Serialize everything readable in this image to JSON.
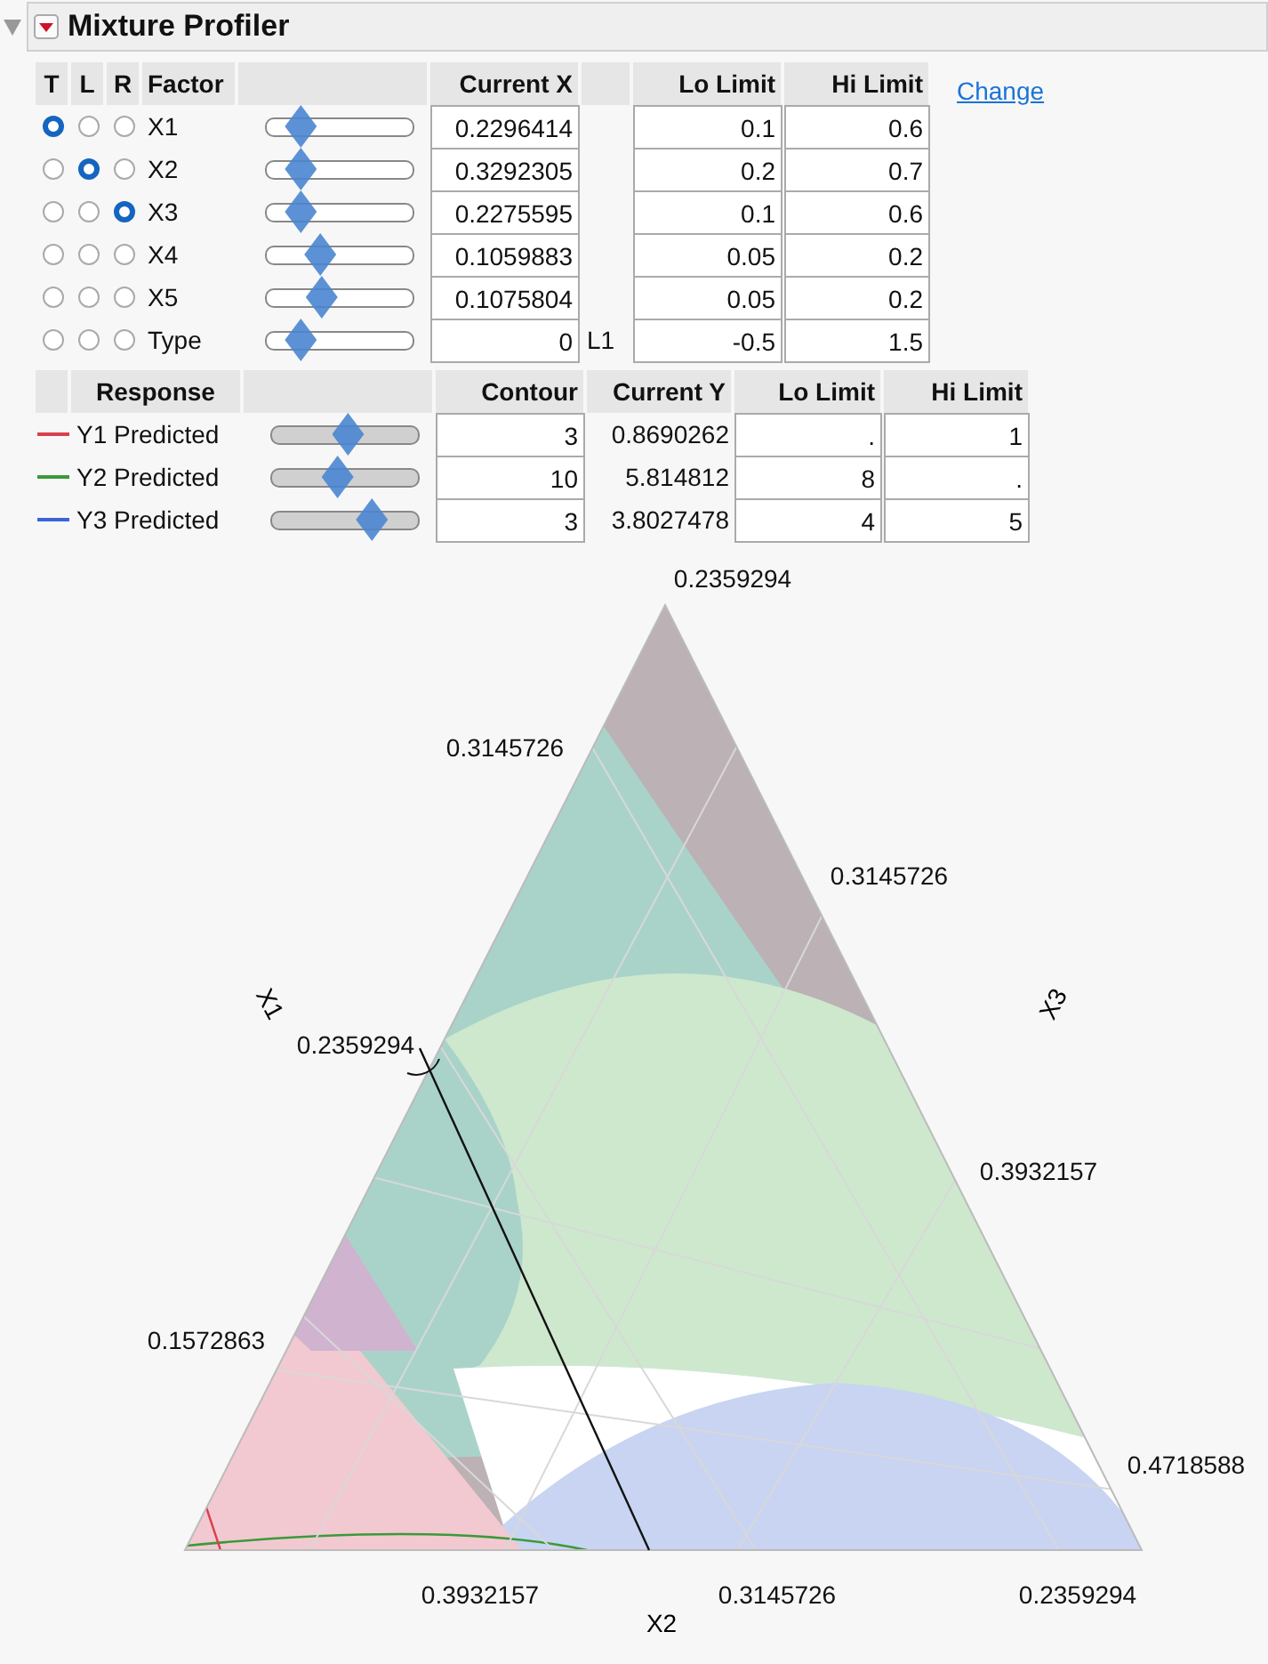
{
  "title": "Mixture Profiler",
  "factor_table": {
    "columns": [
      "T",
      "L",
      "R",
      "Factor",
      "Current X",
      "Lo Limit",
      "Hi Limit"
    ],
    "rows": [
      {
        "t": true,
        "l": false,
        "r": false,
        "name": "X1",
        "level": 0.24,
        "current": "0.2296414",
        "lo": "0.1",
        "hi": "0.6"
      },
      {
        "t": false,
        "l": true,
        "r": false,
        "name": "X2",
        "level": 0.24,
        "current": "0.3292305",
        "lo": "0.2",
        "hi": "0.7"
      },
      {
        "t": false,
        "l": false,
        "r": true,
        "name": "X3",
        "level": 0.24,
        "current": "0.2275595",
        "lo": "0.1",
        "hi": "0.6"
      },
      {
        "t": false,
        "l": false,
        "r": false,
        "name": "X4",
        "level": 0.37,
        "current": "0.1059883",
        "lo": "0.05",
        "hi": "0.2"
      },
      {
        "t": false,
        "l": false,
        "r": false,
        "name": "X5",
        "level": 0.38,
        "current": "0.1075804",
        "lo": "0.05",
        "hi": "0.2"
      },
      {
        "t": false,
        "l": false,
        "r": false,
        "name": "Type",
        "level": 0.24,
        "current": "0",
        "unit": "L1",
        "lo": "-0.5",
        "hi": "1.5"
      }
    ]
  },
  "change_link": "Change",
  "response_table": {
    "columns": [
      "Response",
      "Contour",
      "Current Y",
      "Lo Limit",
      "Hi Limit"
    ],
    "rows": [
      {
        "name": "Y1 Predicted",
        "color": "#d9404f",
        "level": 0.52,
        "contour": "3",
        "current": "0.8690262",
        "lo": ".",
        "hi": "1"
      },
      {
        "name": "Y2 Predicted",
        "color": "#3a9a3a",
        "level": 0.45,
        "contour": "10",
        "current": "5.814812",
        "lo": "8",
        "hi": "."
      },
      {
        "name": "Y3 Predicted",
        "color": "#3a64d8",
        "level": 0.68,
        "contour": "3",
        "current": "3.8027478",
        "lo": "4",
        "hi": "5"
      }
    ]
  },
  "ternary_plot": {
    "axis_labels": [
      "X1",
      "X2",
      "X3"
    ],
    "tick_labels": [
      "0.2359294",
      "0.3145726",
      "0.3145726",
      "0.2359294",
      "0.3932157",
      "0.1572863",
      "0.4718588",
      "0.3932157",
      "0.3145726",
      "0.2359294"
    ]
  }
}
